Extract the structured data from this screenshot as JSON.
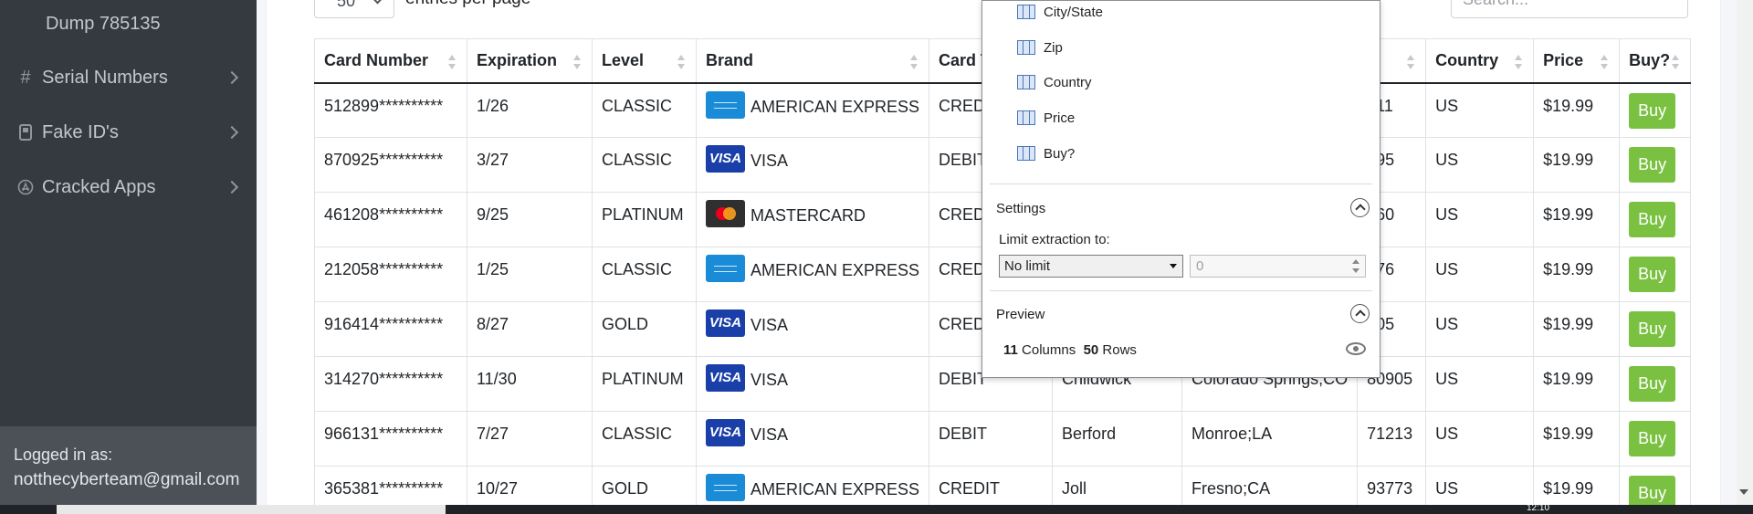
{
  "sidebar": {
    "items": [
      {
        "label": "Dump 785135",
        "icon": ""
      },
      {
        "label": "Serial Numbers",
        "icon": "hash-icon"
      },
      {
        "label": "Fake ID's",
        "icon": "id-card-icon"
      },
      {
        "label": "Cracked Apps",
        "icon": "app-store-icon"
      }
    ],
    "logged_in_label": "Logged in as:",
    "user_email": "notthecyberteam@gmail.com"
  },
  "toolbar": {
    "entries_value": "50",
    "entries_suffix": "entries per page",
    "search_placeholder": "Search..."
  },
  "table": {
    "headers": [
      "Card Number",
      "Expiration",
      "Level",
      "Brand",
      "Card Ty",
      "",
      "",
      "p",
      "Country",
      "Price",
      "Buy?"
    ],
    "rows": [
      {
        "card": "512899**********",
        "exp": "1/26",
        "level": "CLASSIC",
        "brand": "AMERICAN EXPRESS",
        "logo": "amex",
        "type": "CREDIT",
        "c6": "",
        "c7": "",
        "zip": "911",
        "country": "US",
        "price": "$19.99",
        "buy": "Buy"
      },
      {
        "card": "870925**********",
        "exp": "3/27",
        "level": "CLASSIC",
        "brand": "VISA",
        "logo": "visa",
        "type": "DEBIT",
        "c6": "",
        "c7": "",
        "zip": "195",
        "country": "US",
        "price": "$19.99",
        "buy": "Buy"
      },
      {
        "card": "461208**********",
        "exp": "9/25",
        "level": "PLATINUM",
        "brand": "MASTERCARD",
        "logo": "mc",
        "type": "CREDIT",
        "c6": "",
        "c7": "",
        "zip": "260",
        "country": "US",
        "price": "$19.99",
        "buy": "Buy"
      },
      {
        "card": "212058**********",
        "exp": "1/25",
        "level": "CLASSIC",
        "brand": "AMERICAN EXPRESS",
        "logo": "amex",
        "type": "CREDIT",
        "c6": "",
        "c7": "",
        "zip": "076",
        "country": "US",
        "price": "$19.99",
        "buy": "Buy"
      },
      {
        "card": "916414**********",
        "exp": "8/27",
        "level": "GOLD",
        "brand": "VISA",
        "logo": "visa",
        "type": "CREDIT",
        "c6": "",
        "c7": "",
        "zip": "305",
        "country": "US",
        "price": "$19.99",
        "buy": "Buy"
      },
      {
        "card": "314270**********",
        "exp": "11/30",
        "level": "PLATINUM",
        "brand": "VISA",
        "logo": "visa",
        "type": "DEBIT",
        "c6": "Childwick",
        "c7": "Colorado Springs;CO",
        "zip": "80905",
        "country": "US",
        "price": "$19.99",
        "buy": "Buy"
      },
      {
        "card": "966131**********",
        "exp": "7/27",
        "level": "CLASSIC",
        "brand": "VISA",
        "logo": "visa",
        "type": "DEBIT",
        "c6": "Berford",
        "c7": "Monroe;LA",
        "zip": "71213",
        "country": "US",
        "price": "$19.99",
        "buy": "Buy"
      },
      {
        "card": "365381**********",
        "exp": "10/27",
        "level": "GOLD",
        "brand": "AMERICAN EXPRESS",
        "logo": "amex",
        "type": "CREDIT",
        "c6": "Joll",
        "c7": "Fresno;CA",
        "zip": "93773",
        "country": "US",
        "price": "$19.99",
        "buy": "Buy"
      }
    ]
  },
  "popup": {
    "columns": [
      "City/State",
      "Zip",
      "Country",
      "Price",
      "Buy?"
    ],
    "settings_title": "Settings",
    "limit_label": "Limit extraction to:",
    "limit_value": "No limit",
    "limit_number": "0",
    "preview_title": "Preview",
    "columns_count": "11",
    "columns_label": "Columns",
    "rows_count": "50",
    "rows_label": "Rows"
  },
  "taskbar": {
    "clock": "12:10"
  },
  "colors": {
    "sidebar_bg": "#343a40",
    "buy_green": "#7ac142",
    "visa_blue": "#1a3fa8",
    "amex_blue": "#1a8bd6"
  }
}
